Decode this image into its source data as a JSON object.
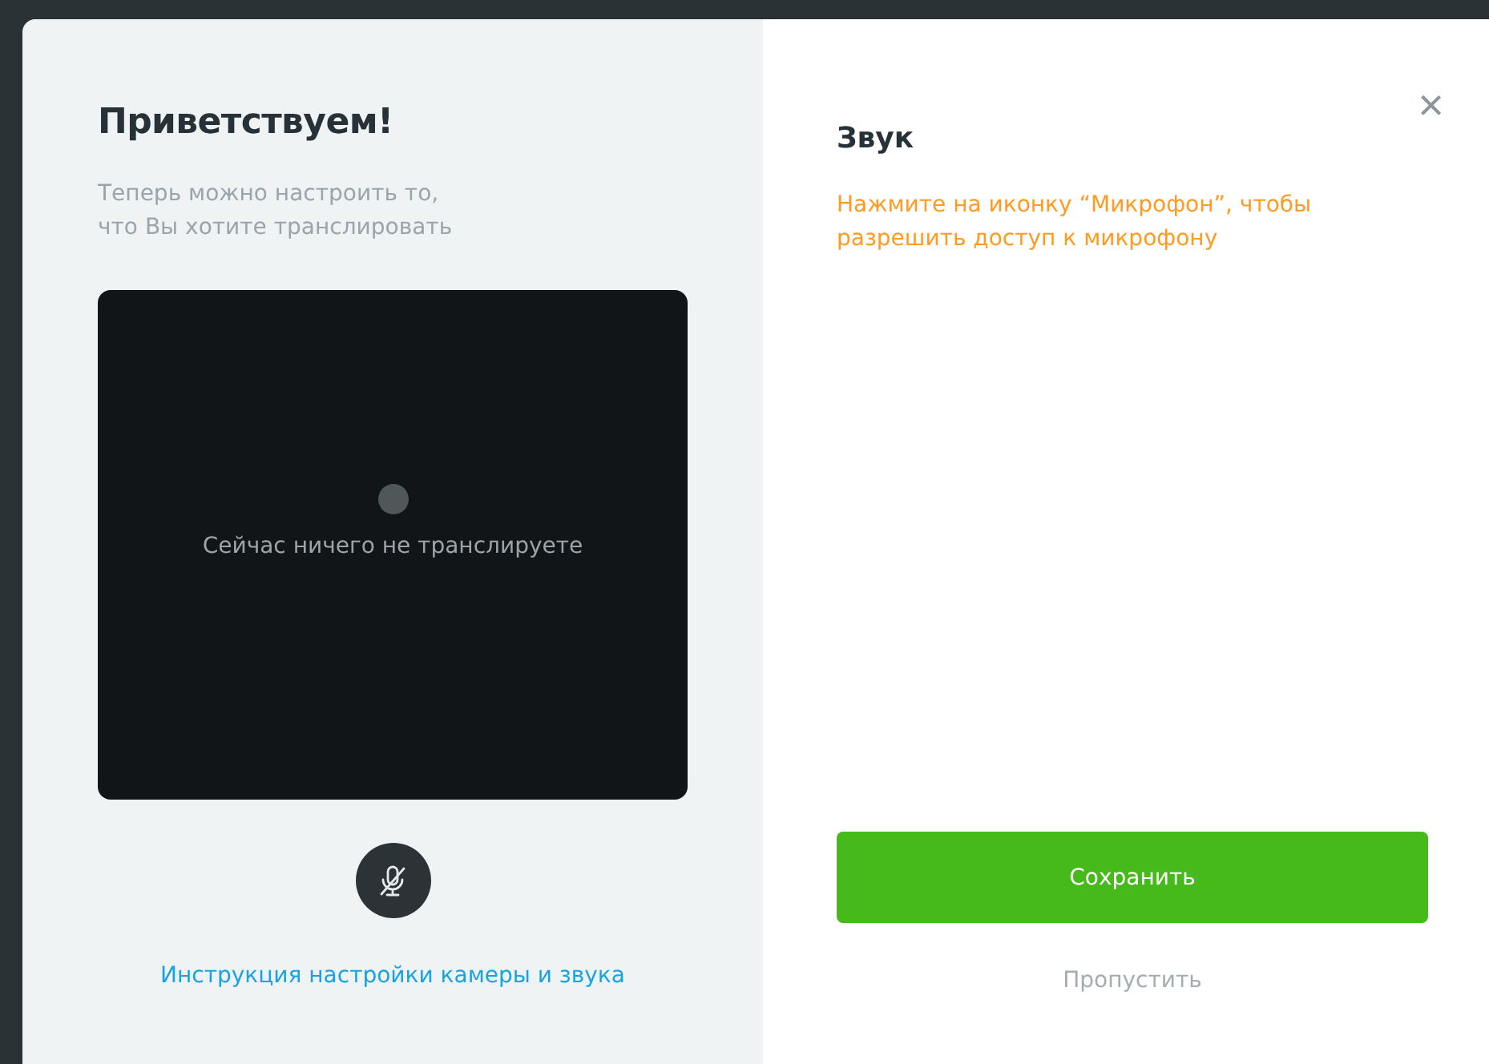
{
  "welcome": {
    "title": "Приветствуем!",
    "subtitle_lines": [
      "Теперь можно настроить то,",
      "что Вы хотите транслировать"
    ]
  },
  "preview": {
    "message": "Сейчас ничего не транслируете"
  },
  "microphone": {
    "muted": true
  },
  "help_link": "Инструкция настройки камеры и звука",
  "sound": {
    "title": "Звук",
    "hint_lines": [
      "Нажмите на иконку “Микрофон”, чтобы",
      "разрешить доступ к микрофону"
    ]
  },
  "close_label": "×",
  "buttons": {
    "save": "Сохранить",
    "skip": "Пропустить"
  }
}
